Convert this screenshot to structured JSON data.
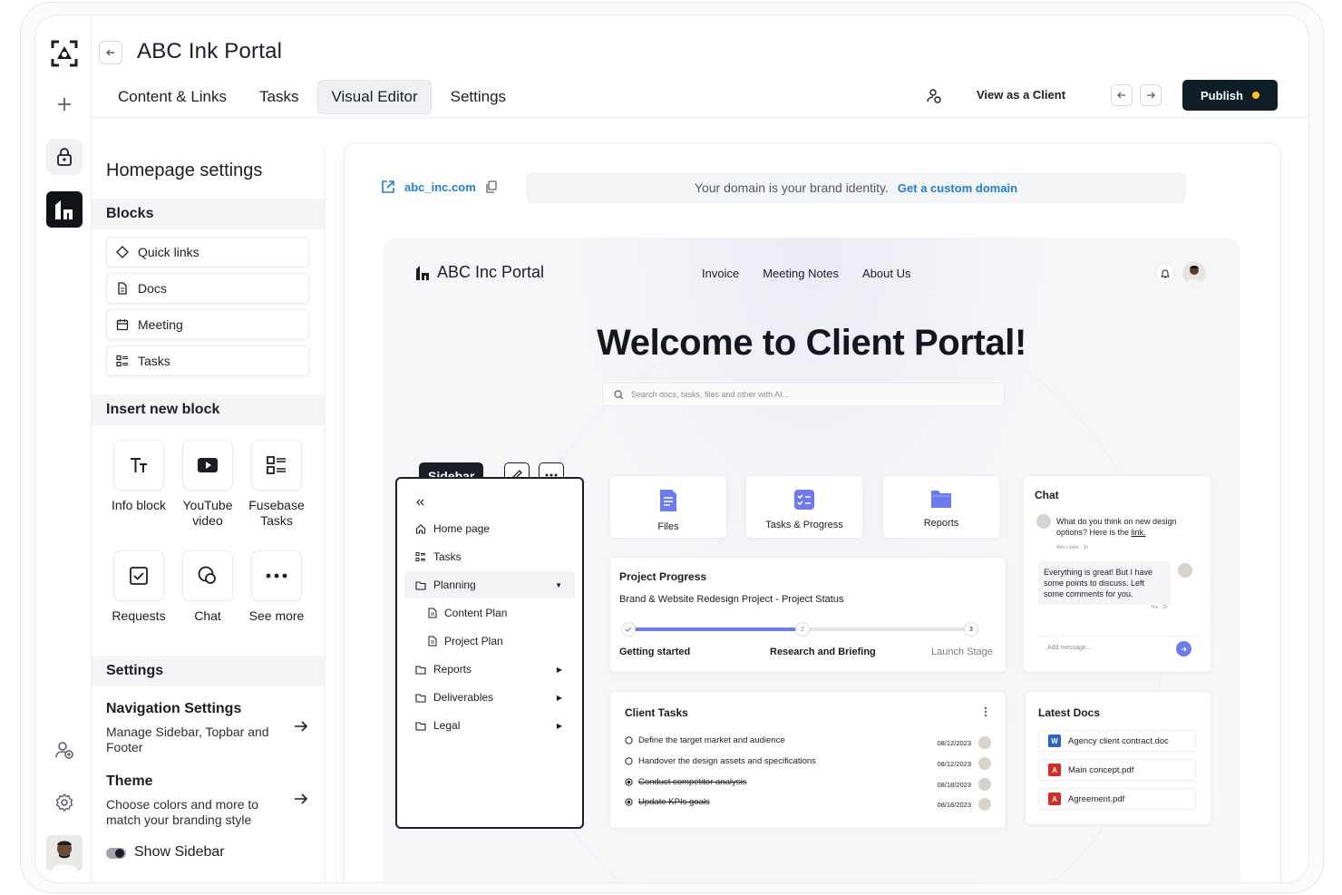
{
  "app": {
    "title": "ABC Ink Portal",
    "tabs": [
      "Content & Links",
      "Tasks",
      "Visual Editor",
      "Settings"
    ],
    "active_tab": "Visual Editor",
    "view_as_client": "View as a Client",
    "publish_label": "Publish"
  },
  "settings_panel": {
    "title": "Homepage settings",
    "blocks_heading": "Blocks",
    "blocks": [
      {
        "label": "Quick links",
        "icon": "diamond-icon"
      },
      {
        "label": "Docs",
        "icon": "doc-icon"
      },
      {
        "label": "Meeting",
        "icon": "calendar-icon"
      },
      {
        "label": "Tasks",
        "icon": "tasks-icon"
      }
    ],
    "insert_heading": "Insert new block",
    "insert_blocks": [
      {
        "label": "Info block",
        "icon": "text-size-icon"
      },
      {
        "label": "YouTube video",
        "icon": "play-icon"
      },
      {
        "label": "Fusebase Tasks",
        "icon": "tasks-icon"
      },
      {
        "label": "Requests",
        "icon": "checkbox-icon"
      },
      {
        "label": "Chat",
        "icon": "chat-icon"
      },
      {
        "label": "See more",
        "icon": "more-icon"
      }
    ],
    "settings_heading": "Settings",
    "navigation": {
      "title": "Navigation Settings",
      "desc": "Manage Sidebar, Topbar and Footer"
    },
    "theme": {
      "title": "Theme",
      "desc": "Choose colors and more to match your branding style"
    },
    "show_sidebar_label": "Show Sidebar",
    "show_sidebar": true
  },
  "canvas": {
    "url": "abc_inc.com",
    "domain_note": "Your domain is your brand identity.",
    "custom_domain_link": "Get a custom domain"
  },
  "preview": {
    "logo_text": "ABC Inc Portal",
    "nav": [
      "Invoice",
      "Meeting Notes",
      "About Us"
    ],
    "heading": "Welcome to Client Portal!",
    "search_placeholder": "Search docs, tasks, files and other with AI...",
    "sidebar_tag": "Sidebar",
    "sidebar_items": [
      {
        "label": "Home page",
        "icon": "home-icon",
        "level": 0
      },
      {
        "label": "Tasks",
        "icon": "tasks-icon",
        "level": 0
      },
      {
        "label": "Planning",
        "icon": "folder-icon",
        "level": 0,
        "caret": "down"
      },
      {
        "label": "Content Plan",
        "icon": "doc-icon",
        "level": 1
      },
      {
        "label": "Project Plan",
        "icon": "doc-icon",
        "level": 1
      },
      {
        "label": "Reports",
        "icon": "folder-icon",
        "level": 0,
        "caret": "right"
      },
      {
        "label": "Deliverables",
        "icon": "folder-icon",
        "level": 0,
        "caret": "right"
      },
      {
        "label": "Legal",
        "icon": "folder-icon",
        "level": 0,
        "caret": "right"
      }
    ],
    "quick_cards": [
      {
        "label": "Files",
        "icon": "file-icon"
      },
      {
        "label": "Tasks & Progress",
        "icon": "checklist-icon"
      },
      {
        "label": "Reports",
        "icon": "folder-icon"
      }
    ],
    "chat": {
      "title": "Chat",
      "msg1": "What do you think on new design options? Here is the",
      "msg1_link": "link.",
      "msg1_meta": "Alex Lovter · 1h",
      "msg2": "Everything is great! But I have some points to discuss. Left some comments for you.",
      "msg2_meta": "You · 2h",
      "input_placeholder": "Add message..."
    },
    "project_progress": {
      "title": "Project Progress",
      "subtitle": "Brand & Website Redesign Project - Project Status",
      "steps": [
        "Getting started",
        "Research and Briefing",
        "Launch Stage"
      ],
      "step_numbers": [
        "2",
        "3"
      ],
      "progress": 0.5
    },
    "client_tasks": {
      "title": "Client Tasks",
      "items": [
        {
          "label": "Define the target market and audience",
          "date": "08/12/2023",
          "done": false
        },
        {
          "label": "Handover the design assets and specifications",
          "date": "08/12/2023",
          "done": false
        },
        {
          "label": "Conduct competitor analysis",
          "date": "08/18/2023",
          "done": true
        },
        {
          "label": "Update KPIs goals",
          "date": "08/18/2023",
          "done": true
        }
      ]
    },
    "latest_docs": {
      "title": "Latest Docs",
      "items": [
        {
          "label": "Agency client contract.doc",
          "type": "word",
          "color": "#2b63c9"
        },
        {
          "label": "Main concept.pdf",
          "type": "pdf",
          "color": "#d72b22"
        },
        {
          "label": "Agreement.pdf",
          "type": "pdf",
          "color": "#d72b22"
        }
      ]
    }
  },
  "colors": {
    "accent": "#6c7cf0",
    "publish_bg": "#0f1d26",
    "publish_dot": "#ffc21a",
    "link": "#1f7fd6"
  }
}
